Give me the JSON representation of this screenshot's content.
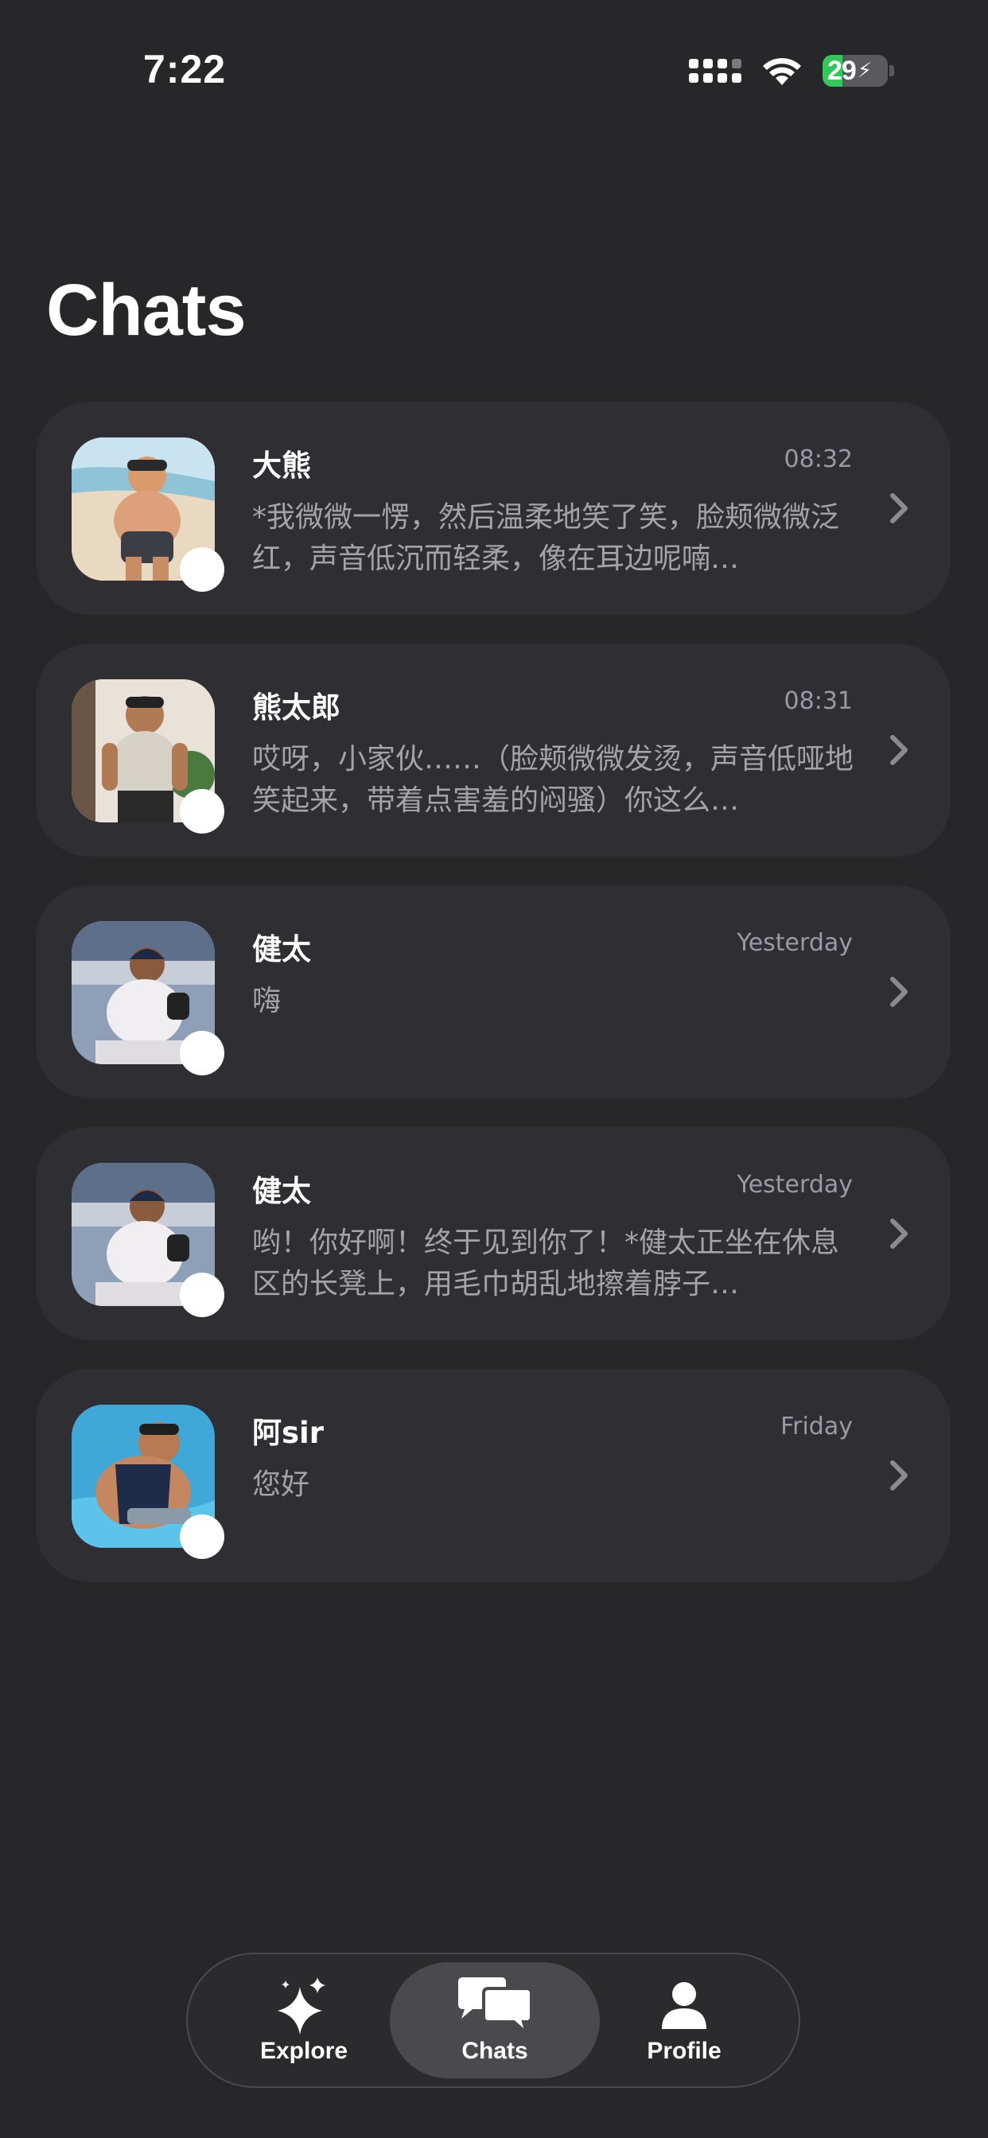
{
  "status_bar": {
    "time": "7:22",
    "battery": "29"
  },
  "page": {
    "title": "Chats"
  },
  "chats": [
    {
      "name": "大熊",
      "time": "08:32",
      "preview": "*我微微一愣，然后温柔地笑了笑，脸颊微微泛红，声音低沉而轻柔，像在耳边呢喃…"
    },
    {
      "name": "熊太郎",
      "time": "08:31",
      "preview": "哎呀，小家伙……（脸颊微微发烫，声音低哑地笑起来，带着点害羞的闷骚）你这么…"
    },
    {
      "name": "健太",
      "time": "Yesterday",
      "preview": "嗨"
    },
    {
      "name": "健太",
      "time": "Yesterday",
      "preview": "哟！你好啊！终于见到你了！*健太正坐在休息区的长凳上，用毛巾胡乱地擦着脖子…"
    },
    {
      "name": "阿sir",
      "time": "Friday",
      "preview": "您好"
    }
  ],
  "tab_bar": {
    "tabs": [
      {
        "label": "Explore",
        "icon": "sparkles-icon"
      },
      {
        "label": "Chats",
        "icon": "chat-bubbles-icon"
      },
      {
        "label": "Profile",
        "icon": "person-icon"
      }
    ],
    "active": "Chats"
  },
  "colors": {
    "background": "#27272a",
    "card": "#2f2f33",
    "battery_green": "#34c759"
  }
}
